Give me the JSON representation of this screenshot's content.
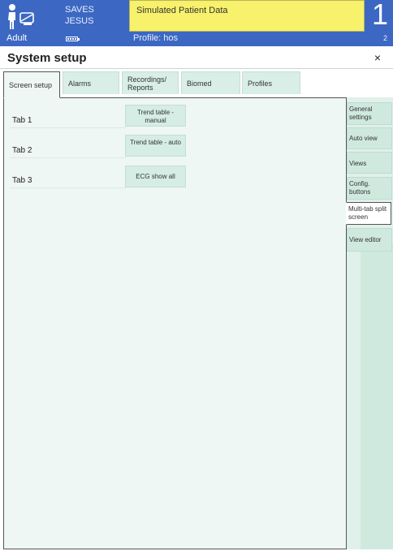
{
  "header": {
    "patient_category": "Adult",
    "patient_name_line1": "SAVES",
    "patient_name_line2": "JESUS",
    "message": "Simulated Patient Data",
    "profile": "Profile: hos",
    "big_number": "1",
    "small_number": "2"
  },
  "window": {
    "title": "System setup",
    "close_label": "×"
  },
  "tabs": [
    {
      "label": "Screen setup"
    },
    {
      "label": "Alarms"
    },
    {
      "label": "Recordings/ Reports"
    },
    {
      "label": "Biomed"
    },
    {
      "label": "Profiles"
    }
  ],
  "main": {
    "tab_labels": [
      "Tab 1",
      "Tab 2",
      "Tab 3"
    ],
    "tab_layouts": [
      "Trend table - manual",
      "Trend table - auto",
      "ECG show all"
    ]
  },
  "side_menu": [
    {
      "label": "General settings"
    },
    {
      "label": "Auto view"
    },
    {
      "label": "Views"
    },
    {
      "label": "Config. buttons"
    },
    {
      "label": "Multi-tab split screen"
    },
    {
      "label": "View editor"
    }
  ],
  "colors": {
    "header_bg": "#3c68c3",
    "message_bg": "#f7f16b",
    "panel_bg": "#eef7f3",
    "button_bg": "#d5ede4"
  }
}
